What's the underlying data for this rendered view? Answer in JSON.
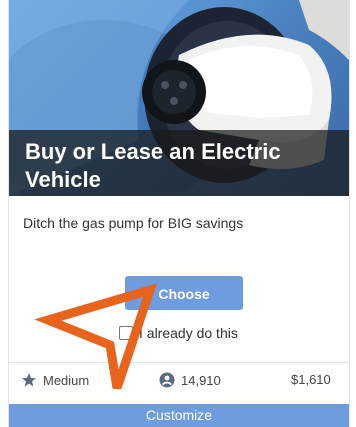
{
  "card": {
    "title": "Buy or Lease an Electric Vehicle",
    "description": "Ditch the gas pump for BIG savings",
    "choose_label": "Choose",
    "already_label": "I already do this",
    "stats": {
      "difficulty": "Medium",
      "people": "14,910",
      "savings_symbol": "$",
      "savings": "$1,610"
    },
    "customize_label": "Customize"
  },
  "colors": {
    "accent": "#6f9bdf",
    "pointer_overlay": "#e8641c"
  },
  "icons": {
    "difficulty": "star-icon",
    "people": "people-icon",
    "savings": "dollar-icon",
    "overlay": "cursor-arrow-icon"
  }
}
